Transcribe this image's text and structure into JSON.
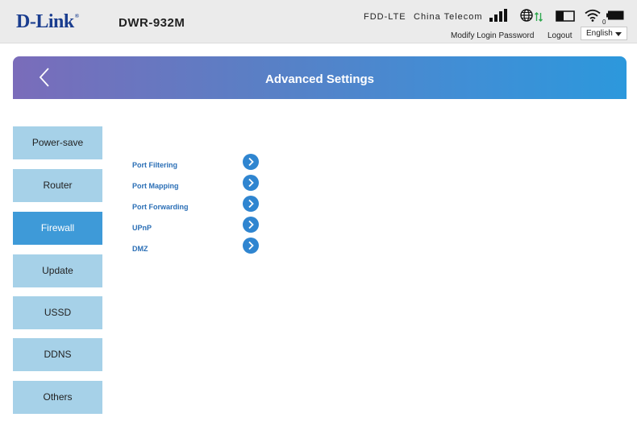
{
  "header": {
    "logo": "D-Link",
    "logo_mark": "®",
    "model": "DWR-932M",
    "network_type": "FDD-LTE",
    "carrier": "China Telecom",
    "wifi_clients": "0",
    "modify_password_label": "Modify Login Password",
    "logout_label": "Logout",
    "language": "English",
    "icons": [
      "signal-strength-icon",
      "globe-icon",
      "data-arrows-icon",
      "sim-card-icon",
      "wifi-icon",
      "battery-icon"
    ],
    "colors": {
      "logo": "#1a3d8f",
      "data_arrows": "#2fa84f"
    }
  },
  "banner": {
    "title": "Advanced Settings",
    "back_icon": "chevron-left-icon",
    "gradient": [
      "#7a6cba",
      "#2c98dc"
    ]
  },
  "sidebar": {
    "items": [
      {
        "label": "Power-save",
        "active": false
      },
      {
        "label": "Router",
        "active": false
      },
      {
        "label": "Firewall",
        "active": true
      },
      {
        "label": "Update",
        "active": false
      },
      {
        "label": "USSD",
        "active": false
      },
      {
        "label": "DDNS",
        "active": false
      },
      {
        "label": "Others",
        "active": false
      }
    ],
    "colors": {
      "item": "#a6d1e8",
      "active": "#3e9ad8"
    }
  },
  "firewall_menu": {
    "items": [
      {
        "label": "Port Filtering"
      },
      {
        "label": "Port Mapping"
      },
      {
        "label": "Port Forwarding"
      },
      {
        "label": "UPnP"
      },
      {
        "label": "DMZ"
      }
    ],
    "go_icon": "chevron-right-circle-icon",
    "colors": {
      "link": "#2b6fb6",
      "go": "#2f85d0"
    }
  }
}
